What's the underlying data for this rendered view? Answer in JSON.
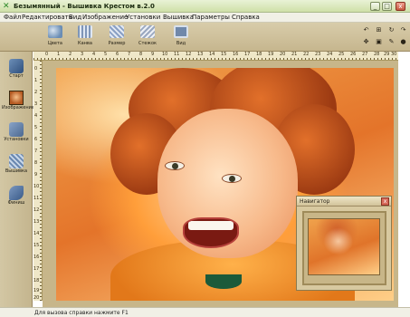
{
  "window": {
    "title": "Безымянный - Вышивка Крестом в.2.0",
    "buttons": {
      "minimize": "_",
      "maximize": "□",
      "close": "x"
    }
  },
  "menu": [
    "Файл",
    "Редактировать",
    "Вид",
    "Изображение",
    "Установки",
    "Вышивка",
    "Параметры",
    "Справка"
  ],
  "toolbar": {
    "buttons": [
      {
        "label": "Цвета",
        "icon": "palette-icon",
        "color": "#6a8db5"
      },
      {
        "label": "Канва",
        "icon": "canvas-grid-icon",
        "color": "#7f96b8"
      },
      {
        "label": "Размер",
        "icon": "resize-icon",
        "color": "#8aa0c4"
      },
      {
        "label": "Стежок",
        "icon": "stitch-icon",
        "color": "#9aa8c0"
      },
      {
        "label": "Вид",
        "icon": "view-icon",
        "color": "#7088aa"
      }
    ]
  },
  "sidebar": {
    "items": [
      {
        "label": "Старт",
        "icon": "needle-icon"
      },
      {
        "label": "Изображение",
        "icon": "image-icon"
      },
      {
        "label": "Установки",
        "icon": "settings-icon"
      },
      {
        "label": "Вышивка",
        "icon": "embroidery-icon"
      },
      {
        "label": "Финиш",
        "icon": "finish-icon"
      }
    ]
  },
  "rulers": {
    "top": [
      "0",
      "1",
      "2",
      "3",
      "4",
      "5",
      "6",
      "7",
      "8",
      "9",
      "10",
      "11",
      "12",
      "13",
      "14",
      "15",
      "16",
      "17",
      "18",
      "19",
      "20",
      "21",
      "22",
      "23",
      "24",
      "25",
      "26",
      "27",
      "28",
      "29",
      "30"
    ],
    "left": [
      "0",
      "1",
      "2",
      "3",
      "4",
      "5",
      "6",
      "7",
      "8",
      "9",
      "10",
      "11",
      "12",
      "13",
      "14",
      "15",
      "16",
      "17",
      "18",
      "19",
      "20"
    ]
  },
  "navigator": {
    "title": "Навигатор",
    "close": "x"
  },
  "status": {
    "text": "Для вызова справки нажмите F1"
  }
}
